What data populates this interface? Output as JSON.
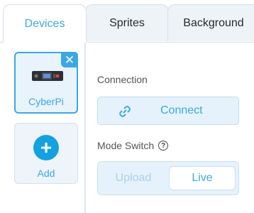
{
  "tabs": [
    {
      "label": "Devices",
      "active": true
    },
    {
      "label": "Sprites",
      "active": false
    },
    {
      "label": "Background",
      "active": false
    }
  ],
  "devices": {
    "items": [
      {
        "label": "CyberPi",
        "selected": true,
        "icon": "cyberpi-device-image",
        "close_icon": "close-icon"
      }
    ],
    "add_label": "Add",
    "add_icon": "plus-icon"
  },
  "connection": {
    "label": "Connection",
    "button_label": "Connect",
    "button_icon": "link-icon"
  },
  "mode_switch": {
    "label": "Mode Switch",
    "help_icon": "question-icon",
    "options": [
      "Upload",
      "Live"
    ],
    "selected": "Live"
  },
  "colors": {
    "accent": "#3ba8e4",
    "add_button": "#14a1e0",
    "panel_bg": "#e6f2fb"
  }
}
